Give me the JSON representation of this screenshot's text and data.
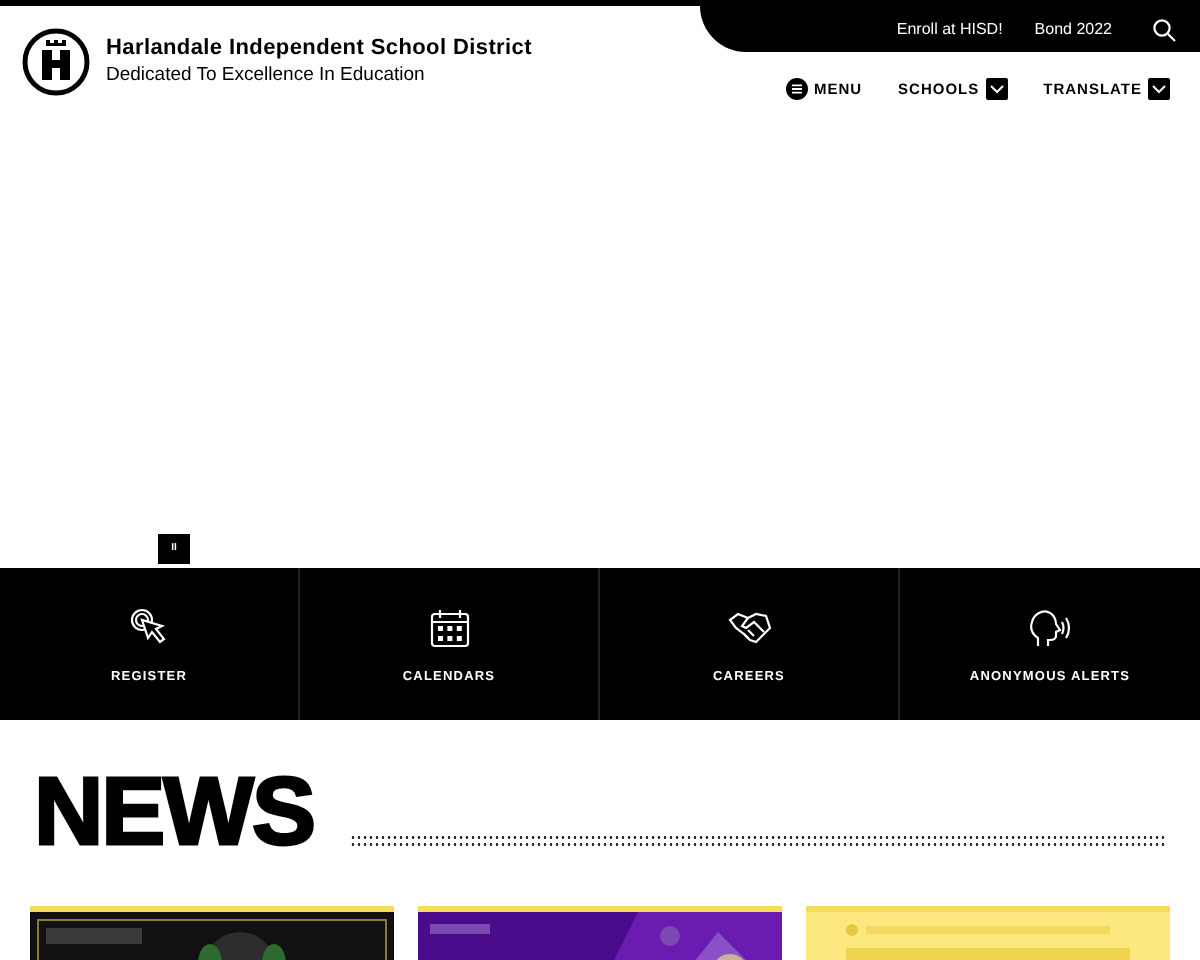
{
  "header": {
    "title": "Harlandale Independent School District",
    "tagline": "Dedicated To Excellence In Education"
  },
  "utility_links": [
    "Enroll at HISD!",
    "Bond 2022"
  ],
  "nav": [
    {
      "label": "MENU",
      "kind": "menu"
    },
    {
      "label": "SCHOOLS",
      "kind": "dropdown"
    },
    {
      "label": "TRANSLATE",
      "kind": "dropdown"
    }
  ],
  "hero": {
    "pause_label": "II"
  },
  "quick_links": [
    {
      "label": "REGISTER",
      "kind": "pointer"
    },
    {
      "label": "CALENDARS",
      "kind": "calendar"
    },
    {
      "label": "CAREERS",
      "kind": "handshake"
    },
    {
      "label": "ANONYMOUS ALERTS",
      "kind": "speaking"
    }
  ],
  "news": {
    "heading": "NEWS"
  }
}
